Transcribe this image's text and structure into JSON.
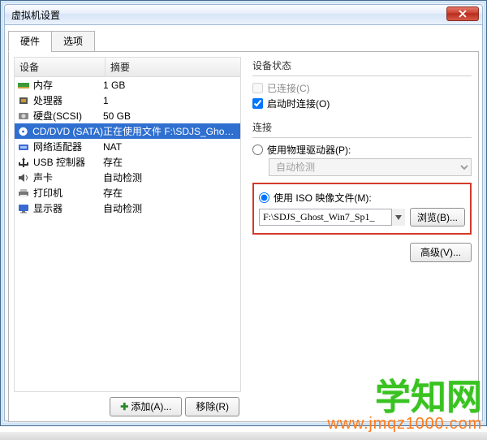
{
  "window": {
    "title": "虚拟机设置"
  },
  "tabs": {
    "hardware": "硬件",
    "options": "选项"
  },
  "table": {
    "head_device": "设备",
    "head_summary": "摘要"
  },
  "devices": [
    {
      "name": "内存",
      "summary": "1 GB",
      "icon": "mem"
    },
    {
      "name": "处理器",
      "summary": "1",
      "icon": "cpu"
    },
    {
      "name": "硬盘(SCSI)",
      "summary": "50 GB",
      "icon": "hdd"
    },
    {
      "name": "CD/DVD (SATA)",
      "summary": "正在使用文件 F:\\SDJS_Ghost_Win7...",
      "icon": "cd",
      "selected": true
    },
    {
      "name": "网络适配器",
      "summary": "NAT",
      "icon": "net"
    },
    {
      "name": "USB 控制器",
      "summary": "存在",
      "icon": "usb"
    },
    {
      "name": "声卡",
      "summary": "自动检测",
      "icon": "snd"
    },
    {
      "name": "打印机",
      "summary": "存在",
      "icon": "prn"
    },
    {
      "name": "显示器",
      "summary": "自动检测",
      "icon": "dsp"
    }
  ],
  "buttons": {
    "add": "添加(A)...",
    "remove": "移除(R)"
  },
  "right": {
    "status_title": "设备状态",
    "connected": "已连接(C)",
    "connect_on_power": "启动时连接(O)",
    "connection_title": "连接",
    "use_physical": "使用物理驱动器(P):",
    "auto_detect": "自动检测",
    "use_iso": "使用 ISO 映像文件(M):",
    "iso_path": "F:\\SDJS_Ghost_Win7_Sp1_",
    "browse": "浏览(B)...",
    "advanced": "高级(V)..."
  },
  "watermark": {
    "cn": "学知网",
    "url": "www.jmqz1000.com"
  }
}
